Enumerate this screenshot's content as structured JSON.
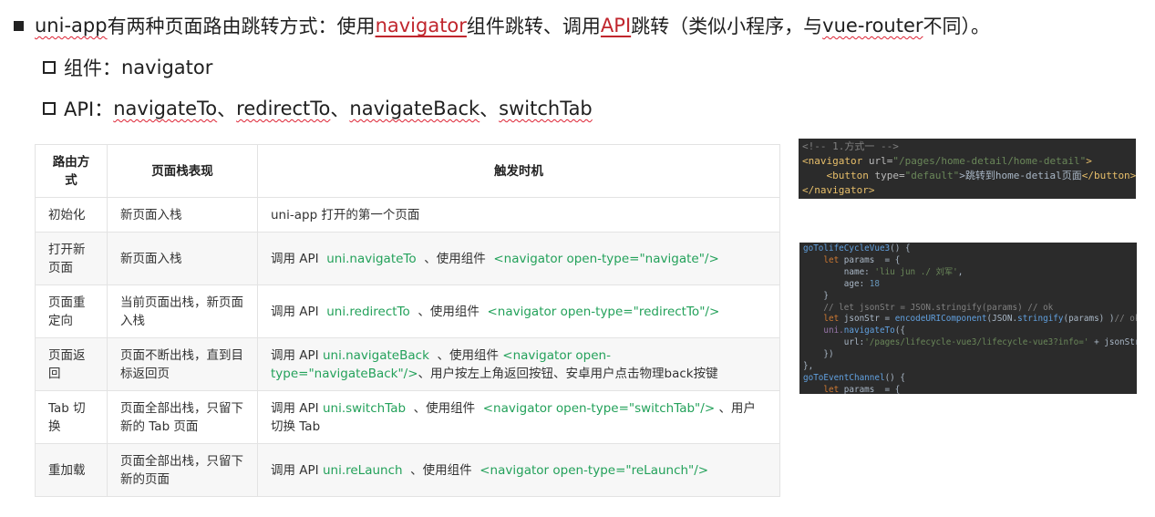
{
  "bullets": {
    "main": {
      "prefix": "uni-app",
      "text1": " 有两种页面路由跳转方式：使用",
      "link1": "navigator",
      "text2": "组件跳转、调用",
      "link2": "API",
      "text3": "跳转（类似小程序，与",
      "vue_router": "vue-router",
      "text4": "不同）。"
    },
    "component": {
      "label": "组件：",
      "value": "navigator"
    },
    "api": {
      "label": "API：",
      "items": [
        "navigateTo",
        "redirectTo",
        "navigateBack",
        "switchTab"
      ],
      "sep": "、"
    }
  },
  "table": {
    "headers": [
      "路由方式",
      "页面栈表现",
      "触发时机"
    ],
    "rows": [
      {
        "method": "初始化",
        "stack": "新页面入栈",
        "trigger_plain": "uni-app 打开的第一个页面"
      },
      {
        "method": "打开新页面",
        "stack": "新页面入栈",
        "api_prefix": "调用 API",
        "api": "uni.navigateTo",
        "mid": "、使用组件",
        "component": "<navigator open-type=\"navigate\"/>"
      },
      {
        "method": "页面重定向",
        "stack": "当前页面出栈，新页面入栈",
        "api_prefix": "调用 API",
        "api": "uni.redirectTo",
        "mid": "、使用组件",
        "component": "<navigator open-type=\"redirectTo\"/>"
      },
      {
        "method": "页面返回",
        "stack": "页面不断出栈，直到目标返回页",
        "api_prefix": "调用 API",
        "api": "uni.navigateBack",
        "mid": "、使用组件",
        "component": "<navigator open-type=\"navigateBack\"/>",
        "suffix": "、用户按左上角返回按钮、安卓用户点击物理back按键"
      },
      {
        "method": "Tab 切换",
        "stack": "页面全部出栈，只留下新的 Tab 页面",
        "api_prefix": "调用 API",
        "api": "uni.switchTab",
        "mid": "、使用组件",
        "component": "<navigator open-type=\"switchTab\"/>",
        "suffix": "、用户切换 Tab"
      },
      {
        "method": "重加载",
        "stack": "页面全部出栈，只留下新的页面",
        "api_prefix": "调用 API",
        "api": "uni.reLaunch",
        "mid": "、使用组件",
        "component": "<navigator open-type=\"reLaunch\"/>"
      }
    ]
  },
  "code1": {
    "comment": "<!-- 1.方式一 -->",
    "nav_open": "<navigator",
    "url_attr": " url=",
    "url_val": "\"/pages/home-detail/home-detail\"",
    "gt": ">",
    "btn_open": "<button",
    "type_attr": " type=",
    "type_val": "\"default\"",
    "btn_text": ">跳转到home-detial页面",
    "btn_close": "</button>",
    "nav_close": "</navigator",
    "nav_close_gt": ">"
  },
  "code2": {
    "fn1": "goTolifeCycleVue3",
    "fn1_rest": "() {",
    "let1": "let",
    "params_decl": " params  = {",
    "name_key": "name",
    "name_val": "'liu jun ./ 刘军'",
    "age_key": "age",
    "age_val": "18",
    "close_brace": "}",
    "comment": "// let jsonStr = JSON.stringify(params) // ok",
    "let2": "let",
    "json_decl": " jsonStr = ",
    "encode_fn": "encodeURIComponent",
    "json_call": "(JSON.",
    "stringify": "stringify",
    "json_rest": "(params) )",
    "json_comment": "// ok",
    "uni_prefix": "uni.",
    "navigate_fn": "navigateTo",
    "nav_paren": "({",
    "url_key": "url",
    "url_val": "'/pages/lifecycle-vue3/lifecycle-vue3?info='",
    "url_plus": " + jsonStr",
    "close_paren": "})",
    "close_fn": "},",
    "fn2": "goToEventChannel",
    "fn2_rest": "() {",
    "let3": "let",
    "params_decl2": " params  = {"
  }
}
